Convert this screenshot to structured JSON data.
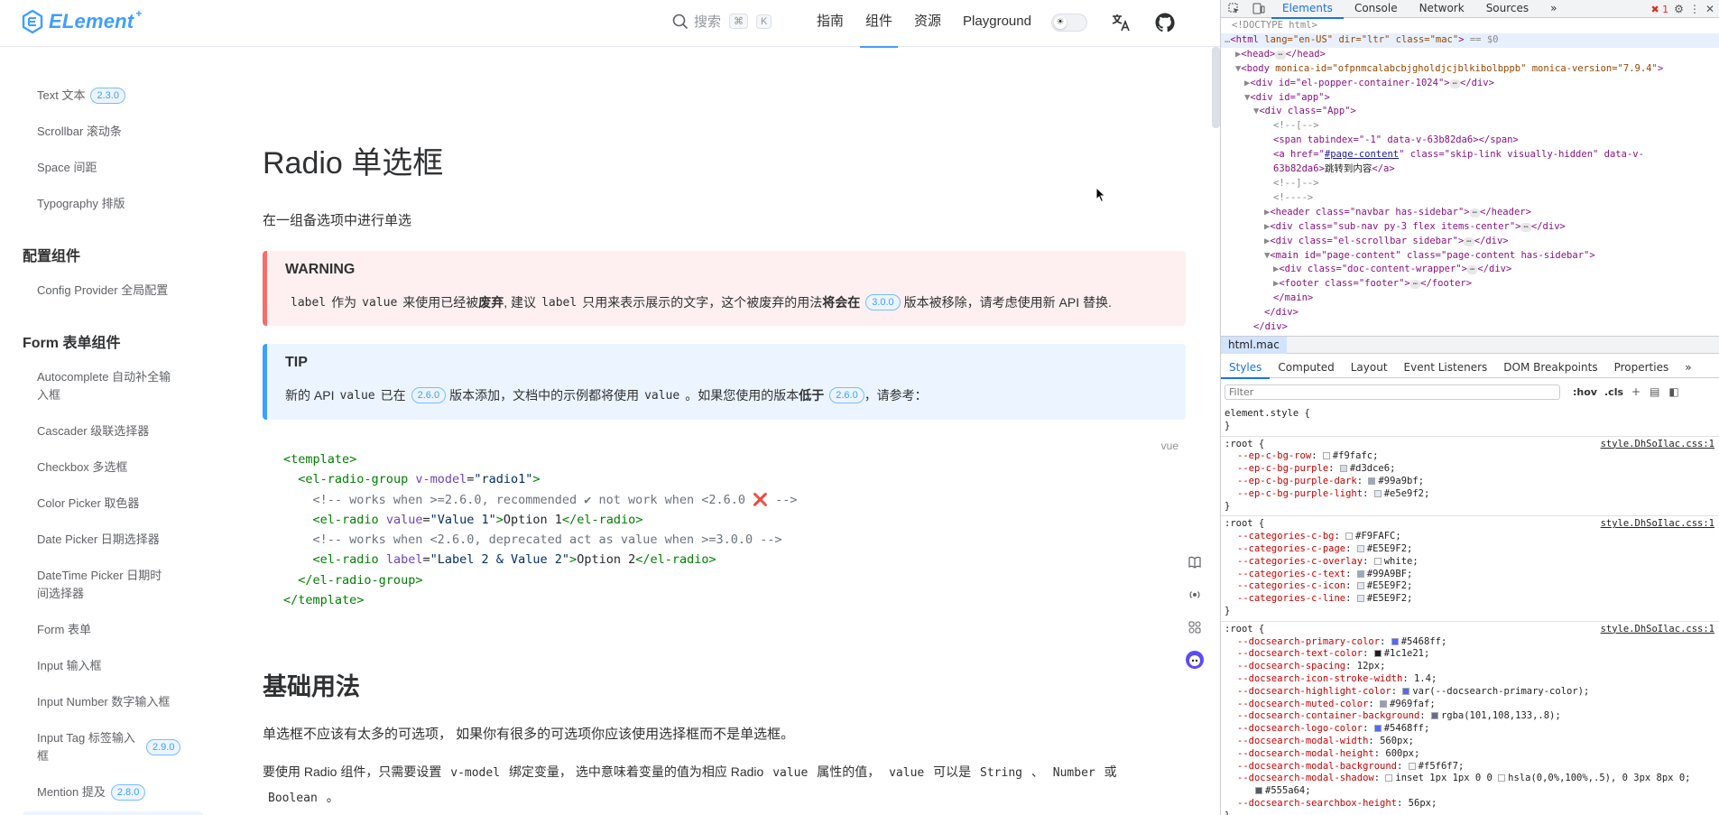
{
  "navbar": {
    "logo_text": "ELement",
    "logo_plus": "+",
    "search_label": "搜索",
    "search_key1": "⌘",
    "search_key2": "K",
    "links": [
      "指南",
      "组件",
      "资源",
      "Playground"
    ],
    "active_link": "组件"
  },
  "sidebar": {
    "items_top": [
      {
        "label": "Text 文本",
        "badge": "2.3.0"
      },
      {
        "label": "Scrollbar 滚动条"
      },
      {
        "label": "Space 间距"
      },
      {
        "label": "Typography 排版"
      }
    ],
    "group_config": "配置组件",
    "config_item": "Config Provider 全局配置",
    "group_form": "Form 表单组件",
    "form_items": [
      {
        "label": "Autocomplete 自动补全输入框"
      },
      {
        "label": "Cascader 级联选择器"
      },
      {
        "label": "Checkbox 多选框"
      },
      {
        "label": "Color Picker 取色器"
      },
      {
        "label": "Date Picker 日期选择器"
      },
      {
        "label": "DateTime Picker 日期时间选择器"
      },
      {
        "label": "Form 表单"
      },
      {
        "label": "Input 输入框"
      },
      {
        "label": "Input Number 数字输入框"
      },
      {
        "label": "Input Tag 标签输入框",
        "badge": "2.9.0"
      },
      {
        "label": "Mention 提及",
        "badge": "2.8.0"
      }
    ]
  },
  "content": {
    "title": "Radio 单选框",
    "desc": "在一组备选项中进行单选",
    "warning": {
      "title": "WARNING",
      "t1": "label",
      "t2": "作为",
      "t3": "value",
      "t4": "来使用已经被",
      "t5": "废弃",
      "t6": ", 建议",
      "t7": "label",
      "t8": "只用来表示展示的文字，这个被废弃的用法",
      "t9": "将会在",
      "version": "3.0.0",
      "t10": "版本被移除，请考虑使用新 API 替换."
    },
    "tip": {
      "title": "TIP",
      "t1": "新的 API",
      "t2": "value",
      "t3": "已在",
      "version1": "2.6.0",
      "t4": "版本添加，文档中的示例都将使用",
      "t5": "value",
      "t6": "。如果您使用的版本",
      "t7": "低于",
      "version2": "2.6.0",
      "t8": "，请参考："
    },
    "code": {
      "lang": "vue",
      "l1_open": "<",
      "l1_tag": "template",
      "l1_close": ">",
      "l2_tag": "el-radio-group",
      "l2_attr": "v-model",
      "l2_val": "\"radio1\"",
      "l3_comment": "<!-- works when >=2.6.0, recommended ✔ not work when <2.6.0",
      "l3_x": "❌",
      "l3_end": "-->",
      "l4_tag": "el-radio",
      "l4_attr": "value",
      "l4_val": "\"Value 1\"",
      "l4_text": "Option 1",
      "l5_comment": "<!-- works when <2.6.0, deprecated act as value when >=3.0.0 -->",
      "l6_tag": "el-radio",
      "l6_attr": "label",
      "l6_val": "\"Label 2 & Value 2\"",
      "l6_text": "Option 2",
      "l7_tag": "el-radio-group",
      "l8_tag": "template"
    },
    "section_title": "基础用法",
    "section_p1": "单选框不应该有太多的可选项， 如果你有很多的可选项你应该使用选择框而不是单选框。",
    "section_p2_a": "要使用 Radio 组件，只需要设置",
    "section_p2_b": "v-model",
    "section_p2_c": "绑定变量， 选中意味着变量的值为相应 Radio",
    "section_p2_d": "value",
    "section_p2_e": "属性的值，",
    "section_p2_f": "value",
    "section_p2_g": "可以是",
    "section_p2_h": "String",
    "section_p2_i": "、",
    "section_p2_j": "Number",
    "section_p2_k": "或",
    "section_p2_l": "Boolean",
    "section_p2_m": "。"
  },
  "devtools": {
    "tabs": [
      "Elements",
      "Console",
      "Network",
      "Sources"
    ],
    "active_tab": "Elements",
    "more": "»",
    "error_count": "1",
    "dom": {
      "doctype": "<!DOCTYPE html>",
      "html_open": "<html",
      "html_attrs": "lang=\"en-US\" dir=\"ltr\" class=\"mac\"",
      "html_close": ">",
      "html_eq": "== $0",
      "head": "<head>",
      "head_end": "</head>",
      "body_open": "<body",
      "body_attrs": "monica-id=\"ofpnmcalabcbjgholdjcjblkibolbppb\" monica-version=\"7.9.4\"",
      "body_close": ">",
      "popper": "<div id=\"el-popper-container-1024\">",
      "popper_end": "</div>",
      "app": "<div id=\"app\">",
      "app_inner": "<div class=\"App\">",
      "c1": "<!--[-->",
      "span": "<span tabindex=\"-1\" data-v-63b82da6></span>",
      "a_open": "<a href=\"",
      "a_link": "#page-content",
      "a_rest": "\" class=\"skip-link visually-hidden\" data-v-",
      "a_rest2": "63b82da6>",
      "a_text": "跳转到内容",
      "a_end": "</a>",
      "c2": "<!--]-->",
      "c3": "<!---->",
      "header": "<header class=\"navbar has-sidebar\">",
      "header_end": "</header>",
      "subnav": "<div class=\"sub-nav py-3 flex items-center\">",
      "subnav_end": "</div>",
      "scrollbar": "<div class=\"el-scrollbar sidebar\">",
      "scrollbar_end": "</div>",
      "main": "<main id=\"page-content\" class=\"page-content has-sidebar\">",
      "doc": "<div class=\"doc-content-wrapper\">",
      "doc_end": "</div>",
      "footer": "<footer class=\"footer\">",
      "footer_end": "</footer>",
      "main_end": "</main>",
      "div_end1": "</div>",
      "div_end2": "</div>"
    },
    "crumb": "html.mac",
    "style_tabs": [
      "Styles",
      "Computed",
      "Layout",
      "Event Listeners",
      "DOM Breakpoints",
      "Properties"
    ],
    "active_style_tab": "Styles",
    "filter_placeholder": "Filter",
    "hov": ":hov",
    "cls": ".cls",
    "element_style": "element.style {",
    "close_brace": "}",
    "rules": [
      {
        "selector": ":root {",
        "source": "style.DhSoIlac.css:1",
        "props": [
          {
            "name": "--ep-c-bg-row",
            "value": "#f9fafc",
            "color": "#f9fafc"
          },
          {
            "name": "--ep-c-bg-purple",
            "value": "#d3dce6",
            "color": "#d3dce6"
          },
          {
            "name": "--ep-c-bg-purple-dark",
            "value": "#99a9bf",
            "color": "#99a9bf"
          },
          {
            "name": "--ep-c-bg-purple-light",
            "value": "#e5e9f2",
            "color": "#e5e9f2"
          }
        ]
      },
      {
        "selector": ":root {",
        "source": "style.DhSoIlac.css:1",
        "props": [
          {
            "name": "--categories-c-bg",
            "value": "#F9FAFC",
            "color": "#F9FAFC"
          },
          {
            "name": "--categories-c-page",
            "value": "#E5E9F2",
            "color": "#E5E9F2"
          },
          {
            "name": "--categories-c-overlay",
            "value": "white",
            "color": "#ffffff"
          },
          {
            "name": "--categories-c-text",
            "value": "#99A9BF",
            "color": "#99A9BF"
          },
          {
            "name": "--categories-c-icon",
            "value": "#E5E9F2",
            "color": "#E5E9F2"
          },
          {
            "name": "--categories-c-line",
            "value": "#E5E9F2",
            "color": "#E5E9F2"
          }
        ]
      },
      {
        "selector": ":root {",
        "source": "style.DhSoIlac.css:1",
        "props": [
          {
            "name": "--docsearch-primary-color",
            "value": "#5468ff",
            "color": "#5468ff"
          },
          {
            "name": "--docsearch-text-color",
            "value": "#1c1e21",
            "color": "#1c1e21"
          },
          {
            "name": "--docsearch-spacing",
            "value": "12px"
          },
          {
            "name": "--docsearch-icon-stroke-width",
            "value": "1.4"
          },
          {
            "name": "--docsearch-highlight-color",
            "value": "var(--docsearch-primary-color)",
            "color": "#5468ff"
          },
          {
            "name": "--docsearch-muted-color",
            "value": "#969faf",
            "color": "#969faf"
          },
          {
            "name": "--docsearch-container-background",
            "value": "rgba(101,108,133,.8)",
            "color": "#656c85"
          },
          {
            "name": "--docsearch-logo-color",
            "value": "#5468ff",
            "color": "#5468ff"
          },
          {
            "name": "--docsearch-modal-width",
            "value": "560px"
          },
          {
            "name": "--docsearch-modal-height",
            "value": "600px"
          },
          {
            "name": "--docsearch-modal-background",
            "value": "#f5f6f7",
            "color": "#f5f6f7"
          },
          {
            "name": "--docsearch-modal-shadow",
            "value": "inset 1px 1px 0 0 ",
            "value2": "hsla(0,0%,100%,.5), 0 3px 8px 0",
            "color": "#ffffff"
          },
          {
            "name": "",
            "value": "#555a64",
            "color": "#555a64"
          },
          {
            "name": "--docsearch-searchbox-height",
            "value": "56px"
          }
        ]
      }
    ]
  },
  "colors": {
    "accent": "#409eff",
    "warning_border": "#f56c6c",
    "devtools_accent": "#1a73e8"
  }
}
